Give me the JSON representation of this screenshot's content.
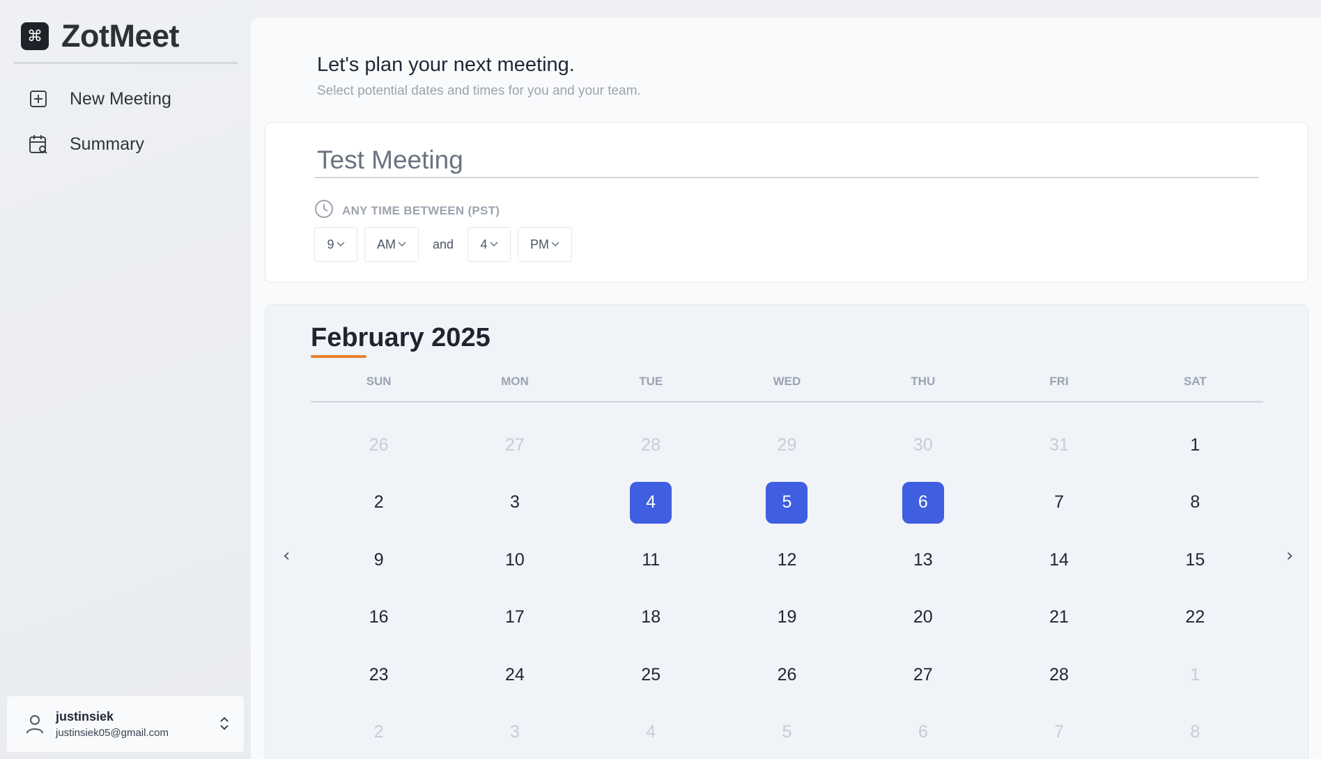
{
  "brand": {
    "logo_glyph": "⌘",
    "name": "ZotMeet"
  },
  "nav": [
    {
      "label": "New Meeting",
      "icon": "plus-square-icon"
    },
    {
      "label": "Summary",
      "icon": "calendar-search-icon"
    }
  ],
  "user": {
    "name": "justinsiek",
    "email": "justinsiek05@gmail.com"
  },
  "main": {
    "headline": "Let's plan your next meeting.",
    "subline": "Select potential dates and times for you and your team."
  },
  "meeting": {
    "title_value": "Test Meeting",
    "time_label": "ANY TIME BETWEEN (PST)",
    "start_hour": "9",
    "start_ampm": "AM",
    "and_label": "and",
    "end_hour": "4",
    "end_ampm": "PM"
  },
  "calendar": {
    "month_label": "February 2025",
    "prev_glyph": "‹",
    "next_glyph": "›",
    "weekdays": [
      "SUN",
      "MON",
      "TUE",
      "WED",
      "THU",
      "FRI",
      "SAT"
    ],
    "accent_color": "#e8812b",
    "selected_color": "#3f5fe0",
    "weeks": [
      [
        {
          "d": "26",
          "m": true
        },
        {
          "d": "27",
          "m": true
        },
        {
          "d": "28",
          "m": true
        },
        {
          "d": "29",
          "m": true
        },
        {
          "d": "30",
          "m": true
        },
        {
          "d": "31",
          "m": true
        },
        {
          "d": "1"
        }
      ],
      [
        {
          "d": "2"
        },
        {
          "d": "3"
        },
        {
          "d": "4",
          "s": true
        },
        {
          "d": "5",
          "s": true
        },
        {
          "d": "6",
          "s": true
        },
        {
          "d": "7"
        },
        {
          "d": "8"
        }
      ],
      [
        {
          "d": "9"
        },
        {
          "d": "10"
        },
        {
          "d": "11"
        },
        {
          "d": "12"
        },
        {
          "d": "13"
        },
        {
          "d": "14"
        },
        {
          "d": "15"
        }
      ],
      [
        {
          "d": "16"
        },
        {
          "d": "17"
        },
        {
          "d": "18"
        },
        {
          "d": "19"
        },
        {
          "d": "20"
        },
        {
          "d": "21"
        },
        {
          "d": "22"
        }
      ],
      [
        {
          "d": "23"
        },
        {
          "d": "24"
        },
        {
          "d": "25"
        },
        {
          "d": "26"
        },
        {
          "d": "27"
        },
        {
          "d": "28"
        },
        {
          "d": "1",
          "m": true
        }
      ],
      [
        {
          "d": "2",
          "m": true
        },
        {
          "d": "3",
          "m": true
        },
        {
          "d": "4",
          "m": true
        },
        {
          "d": "5",
          "m": true
        },
        {
          "d": "6",
          "m": true
        },
        {
          "d": "7",
          "m": true
        },
        {
          "d": "8",
          "m": true
        }
      ]
    ]
  }
}
